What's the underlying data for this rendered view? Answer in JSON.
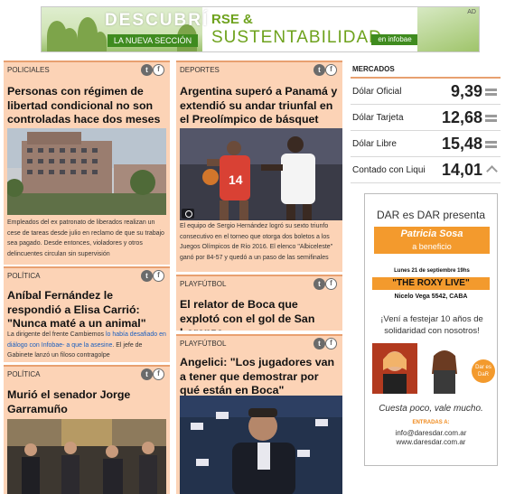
{
  "banner": {
    "descubri": "DESCUBRÍ",
    "nueva": "LA NUEVA SECCIÓN",
    "rse": "RSE &",
    "sustentabilidad": "SUSTENTABILIDAD",
    "infobae": "en infobae",
    "ad_badge": "AD"
  },
  "cards": [
    {
      "section": "POLICIALES",
      "title": "Personas con régimen de libertad condicional no son controladas hace dos meses",
      "summary": "Empleados del ex patronato de liberados realizan un cese de tareas desde julio en reclamo de que su trabajo sea pagado. Desde entonces, violadores y otros delincuentes circulan sin supervisión"
    },
    {
      "section": "DEPORTES",
      "title": "Argentina superó a Panamá y extendió su andar triunfal en el Preolímpico de básquet",
      "summary": "El equipo de Sergio Hernández logró su sexto triunfo consecutivo en el torneo que otorga dos boletos a los Juegos Olímpicos de Río 2016. El elenco \"Albiceleste\" ganó por 84-57 y quedó a un paso de las semifinales"
    },
    {
      "section": "POLÍTICA",
      "title": "Aníbal Fernández le respondió a Elisa Carrió: \"Nunca maté a un animal\"",
      "summary_a": "La dirigente del frente Cambiemos ",
      "summary_link": "lo había desafiado en diálogo con Infobae- a que la asesine",
      "summary_b": ". El jefe de Gabinete lanzó un filoso contragolpe"
    },
    {
      "section": "PLAYFÚTBOL",
      "title": "El relator de Boca que explotó con el gol de San Lorenzo"
    },
    {
      "section": "POLÍTICA",
      "title": "Murió el senador Jorge Garramuño"
    },
    {
      "section": "PLAYFÚTBOL",
      "title": "Angelici: \"Los jugadores van a tener que demostrar por qué están en Boca\""
    }
  ],
  "social": {
    "twitter": "t",
    "facebook": "f"
  },
  "markets": {
    "title": "MERCADOS",
    "rows": [
      {
        "label": "Dólar Oficial",
        "value": "9,39",
        "trend": "equal"
      },
      {
        "label": "Dólar Tarjeta",
        "value": "12,68",
        "trend": "equal"
      },
      {
        "label": "Dólar Libre",
        "value": "15,48",
        "trend": "equal"
      },
      {
        "label": "Contado con Liqui",
        "value": "14,01",
        "trend": "up"
      }
    ]
  },
  "dar_ad": {
    "heading": "DAR es DAR presenta",
    "artist": "Patricia Sosa",
    "benefit": "a beneficio",
    "date": "Lunes 21 de septiembre 19hs",
    "venue": "\"THE ROXY LIVE\"",
    "address": "Nicelo Vega 5542, CABA",
    "festejo": "¡Vení a festejar 10 años de solidaridad con nosotros!",
    "cuesta": "Cuesta poco, vale mucho.",
    "entradas": "ENTRADAS A:",
    "email": "info@daresdar.com.ar",
    "web": "www.daresdar.com.ar",
    "logo": "Dar es DaR"
  }
}
